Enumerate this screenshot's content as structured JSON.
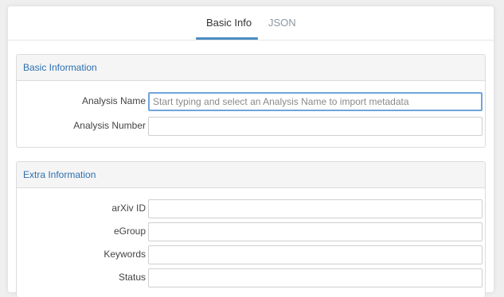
{
  "tabs": [
    {
      "label": "Basic Info"
    },
    {
      "label": "JSON"
    }
  ],
  "basic_section": {
    "title": "Basic Information",
    "fields": [
      {
        "label": "Analysis Name",
        "value": "",
        "placeholder": "Start typing and select an Analysis Name to import metadata"
      },
      {
        "label": "Analysis Number",
        "value": "",
        "placeholder": ""
      }
    ]
  },
  "extra_section": {
    "title": "Extra Information",
    "fields": [
      {
        "label": "arXiv ID",
        "value": ""
      },
      {
        "label": "eGroup",
        "value": ""
      },
      {
        "label": "Keywords",
        "value": ""
      },
      {
        "label": "Status",
        "value": ""
      }
    ]
  },
  "colors": {
    "accent": "#4a8bc2",
    "section_title": "#2c6fb0",
    "focus_border": "#6fa4dc"
  }
}
